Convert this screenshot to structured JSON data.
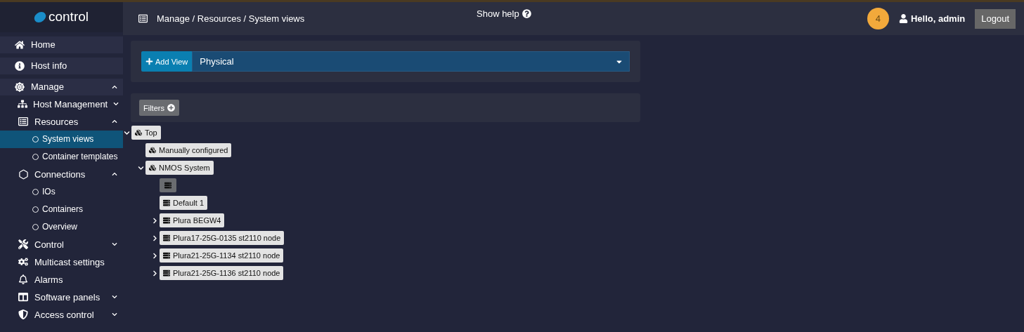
{
  "sidebar": {
    "logo": "control",
    "items": [
      {
        "label": "Home"
      },
      {
        "label": "Host info"
      },
      {
        "label": "Manage",
        "expanded": true,
        "children": [
          {
            "label": "Host Management",
            "expanded": false
          },
          {
            "label": "Resources",
            "expanded": true,
            "children": [
              {
                "label": "System views",
                "selected": true
              },
              {
                "label": "Container templates",
                "selected": false
              }
            ]
          },
          {
            "label": "Connections",
            "expanded": true,
            "children": [
              {
                "label": "IOs",
                "selected": false
              },
              {
                "label": "Containers",
                "selected": false
              },
              {
                "label": "Overview",
                "selected": false
              }
            ]
          },
          {
            "label": "Control",
            "expanded": false
          },
          {
            "label": "Multicast settings"
          },
          {
            "label": "Alarms"
          },
          {
            "label": "Software panels",
            "expanded": false
          },
          {
            "label": "Access control",
            "expanded": false
          }
        ]
      }
    ]
  },
  "header": {
    "breadcrumb": "Manage / Resources / System views",
    "help": "Show help",
    "notifications": "4",
    "greeting": "Hello, admin",
    "logout": "Logout"
  },
  "view_bar": {
    "add_button": "Add View",
    "view_select": "Physical"
  },
  "filters": {
    "label": "Filters"
  },
  "tree": [
    {
      "label": "Top",
      "kind": "group",
      "expanded": true,
      "selected": false,
      "children": [
        {
          "label": "Manually configured",
          "kind": "group",
          "selected": false
        },
        {
          "label": "NMOS System",
          "kind": "group",
          "expanded": true,
          "selected": false,
          "children": [
            {
              "kind": "device",
              "selected": true
            },
            {
              "label": "Default 1",
              "kind": "device",
              "selected": false
            },
            {
              "label": "Plura BEGW4",
              "kind": "device",
              "expanded": false,
              "selected": false
            },
            {
              "label": "Plura17-25G-0135 st2110 node",
              "kind": "device",
              "expanded": false,
              "selected": false
            },
            {
              "label": "Plura21-25G-1134 st2110 node",
              "kind": "device",
              "expanded": false,
              "selected": false
            },
            {
              "label": "Plura21-25G-1136 st2110 node",
              "kind": "device",
              "expanded": false,
              "selected": false
            }
          ]
        }
      ]
    }
  ]
}
